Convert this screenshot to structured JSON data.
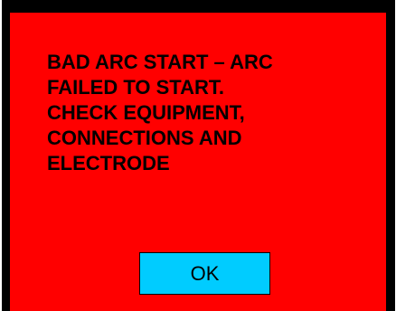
{
  "dialog": {
    "message": "BAD ARC START – ARC\nFAILED TO START.\nCHECK EQUIPMENT,\nCONNECTIONS AND\nELECTRODE",
    "ok_label": "OK"
  },
  "colors": {
    "background": "#ff0000",
    "frame": "#000000",
    "button": "#00ccff",
    "text": "#000000"
  }
}
